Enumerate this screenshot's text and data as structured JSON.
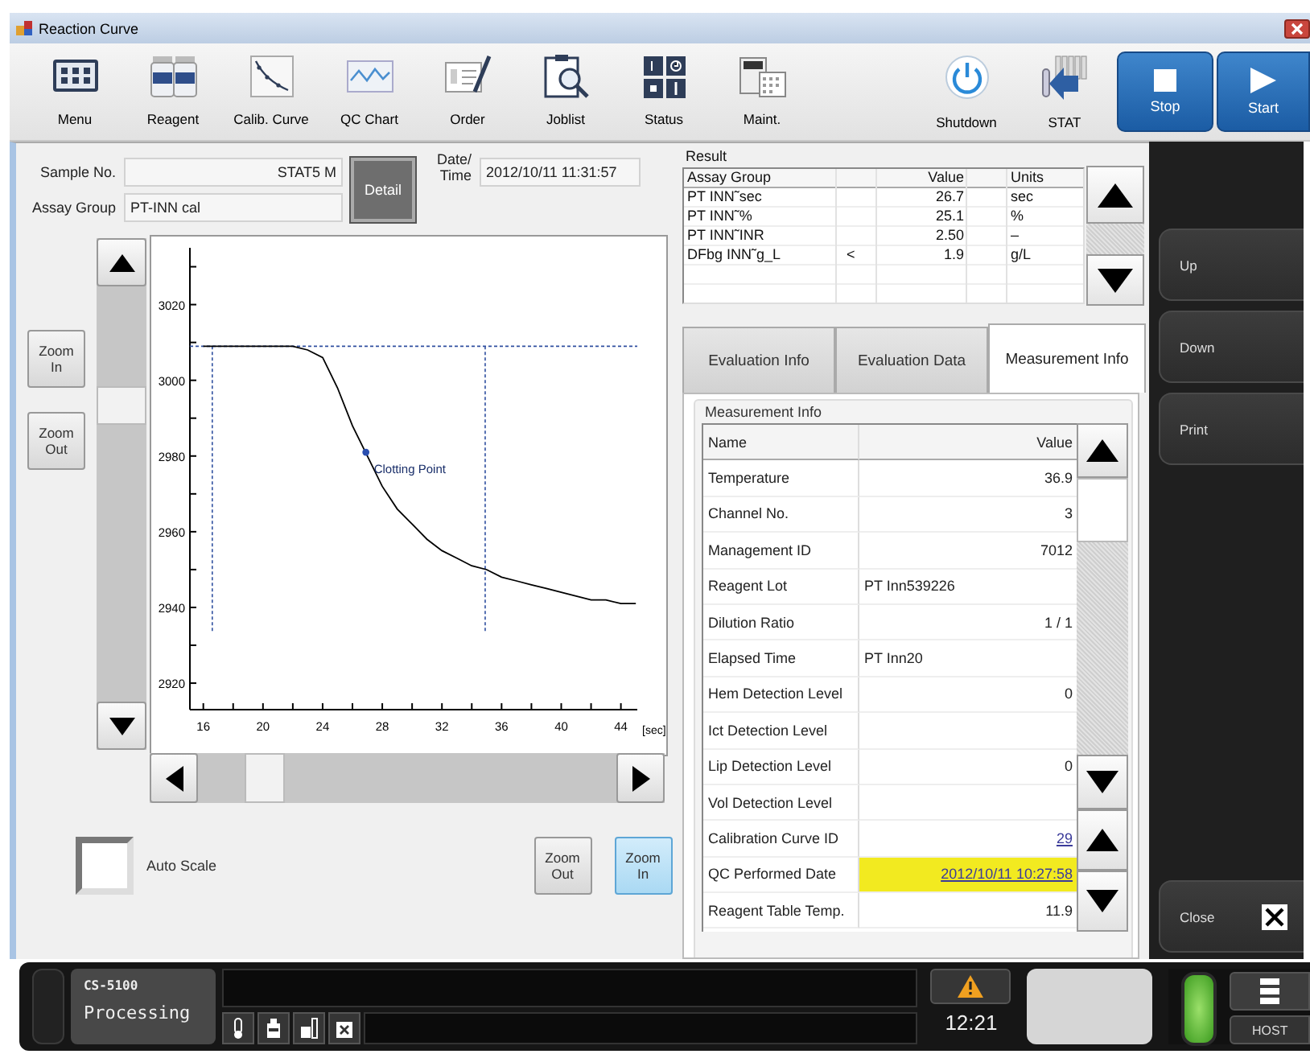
{
  "window": {
    "title": "Reaction Curve"
  },
  "toolbar": {
    "items": [
      {
        "label": "Menu"
      },
      {
        "label": "Reagent"
      },
      {
        "label": "Calib. Curve"
      },
      {
        "label": "QC Chart"
      },
      {
        "label": "Order"
      },
      {
        "label": "Joblist"
      },
      {
        "label": "Status"
      },
      {
        "label": "Maint."
      }
    ],
    "right_items": [
      {
        "label": "Shutdown"
      },
      {
        "label": "STAT"
      }
    ],
    "run_buttons": [
      {
        "label": "Stop",
        "kind": "stop"
      },
      {
        "label": "Start",
        "kind": "start"
      }
    ]
  },
  "sample": {
    "sample_no_label": "Sample No.",
    "sample_no": "STAT5 M",
    "assay_group_label": "Assay Group",
    "assay_group": "PT-INN cal",
    "detail_button": "Detail",
    "datetime_label": "Date/ Time",
    "datetime": "2012/10/11 11:31:57"
  },
  "graph": {
    "zoom_buttons": [
      {
        "label": "Zoom In"
      },
      {
        "label": "Zoom Out"
      }
    ],
    "chart_data": {
      "type": "line",
      "xlabel": "[sec]",
      "x": [
        16,
        17,
        18,
        19,
        20,
        21,
        22,
        23,
        24,
        25,
        26,
        27,
        28,
        29,
        30,
        31,
        32,
        33,
        34,
        35,
        36,
        37,
        38,
        39,
        40,
        41,
        42,
        43,
        44,
        45
      ],
      "series": [
        {
          "color": "#000000",
          "values": [
            3009,
            3009,
            3009,
            3009,
            3009,
            3009,
            3009,
            3008,
            3006,
            2998,
            2988,
            2980,
            2972,
            2966,
            2962,
            2958,
            2955,
            2953,
            2951,
            2950,
            2948,
            2947,
            2946,
            2945,
            2944,
            2943,
            2942,
            2942,
            2941,
            2941
          ]
        }
      ],
      "xlim": [
        15.1,
        45.1
      ],
      "ylim": [
        2913,
        3035
      ],
      "xticks": [
        16,
        20,
        24,
        28,
        32,
        36,
        40,
        44
      ],
      "yticks": [
        2920,
        2940,
        2960,
        2980,
        3000,
        3020
      ],
      "annotations": [
        {
          "text": "Clotting Point",
          "x": 26.9,
          "y": 2981
        }
      ],
      "ref_lines": [
        {
          "axis": "y",
          "value": 3009
        },
        {
          "axis": "x",
          "value": 16.6
        },
        {
          "axis": "x",
          "value": 34.9
        }
      ]
    }
  },
  "graph_controls": {
    "auto_scale": {
      "label": "Auto Scale",
      "checked": false
    },
    "zoom_buttons": [
      {
        "label": "Zoom Out",
        "active": false
      },
      {
        "label": "Zoom In",
        "active": true
      }
    ]
  },
  "result": {
    "title": "Result",
    "columns": [
      "Assay Group",
      "Value",
      "Units"
    ],
    "rows": [
      {
        "assay_group": "PT INN˜sec",
        "value": "26.7",
        "units": "sec"
      },
      {
        "assay_group": "PT INN˜%",
        "value": "25.1",
        "units": "%"
      },
      {
        "assay_group": "PT INN˜INR",
        "value": "2.50",
        "units": "–"
      },
      {
        "assay_group": "DFbg INN˜g_L",
        "flag": "<",
        "value": "1.9",
        "units": "g/L"
      }
    ]
  },
  "tabs": [
    {
      "label": "Evaluation Info",
      "selected": false
    },
    {
      "label": "Evaluation Data",
      "selected": false
    },
    {
      "label": "Measurement Info",
      "selected": true
    }
  ],
  "measurement_info": {
    "title": "Measurement Info",
    "columns": [
      "Name",
      "Value"
    ],
    "rows": [
      {
        "name": "Temperature",
        "value": "36.9",
        "kind": "number",
        "highlighted": false
      },
      {
        "name": "Channel No.",
        "value": "3",
        "kind": "number",
        "highlighted": false
      },
      {
        "name": "Management ID",
        "value": "7012",
        "kind": "number",
        "highlighted": false
      },
      {
        "name": "Reagent Lot",
        "value": "PT Inn539226",
        "kind": "text",
        "highlighted": false
      },
      {
        "name": "Dilution Ratio",
        "value": "1 / 1",
        "kind": "number",
        "highlighted": false
      },
      {
        "name": "Elapsed Time",
        "value": "PT Inn20",
        "kind": "text",
        "highlighted": false
      },
      {
        "name": "Hem Detection Level",
        "value": "0",
        "kind": "number",
        "highlighted": false
      },
      {
        "name": "Ict Detection Level",
        "kind": "number",
        "highlighted": false
      },
      {
        "name": "Lip Detection Level",
        "value": "0",
        "kind": "number",
        "highlighted": false
      },
      {
        "name": "Vol Detection Level",
        "kind": "number",
        "highlighted": false
      },
      {
        "name": "Calibration Curve ID",
        "value": "29",
        "kind": "link",
        "highlighted": false
      },
      {
        "name": "QC Performed Date",
        "value": "2012/10/11 10:27:58",
        "kind": "link",
        "highlighted": true
      },
      {
        "name": "Reagent Table Temp.",
        "value": "11.9",
        "kind": "number",
        "highlighted": false
      }
    ]
  },
  "side_buttons": [
    {
      "label": "Up",
      "kind": "plain"
    },
    {
      "label": "Down",
      "kind": "plain"
    },
    {
      "label": "Print",
      "kind": "plain"
    },
    {
      "label": "Close",
      "kind": "close"
    }
  ],
  "status_bar": {
    "model": "CS-5100",
    "state": "Processing",
    "time": "12:21",
    "host_button": "HOST"
  }
}
